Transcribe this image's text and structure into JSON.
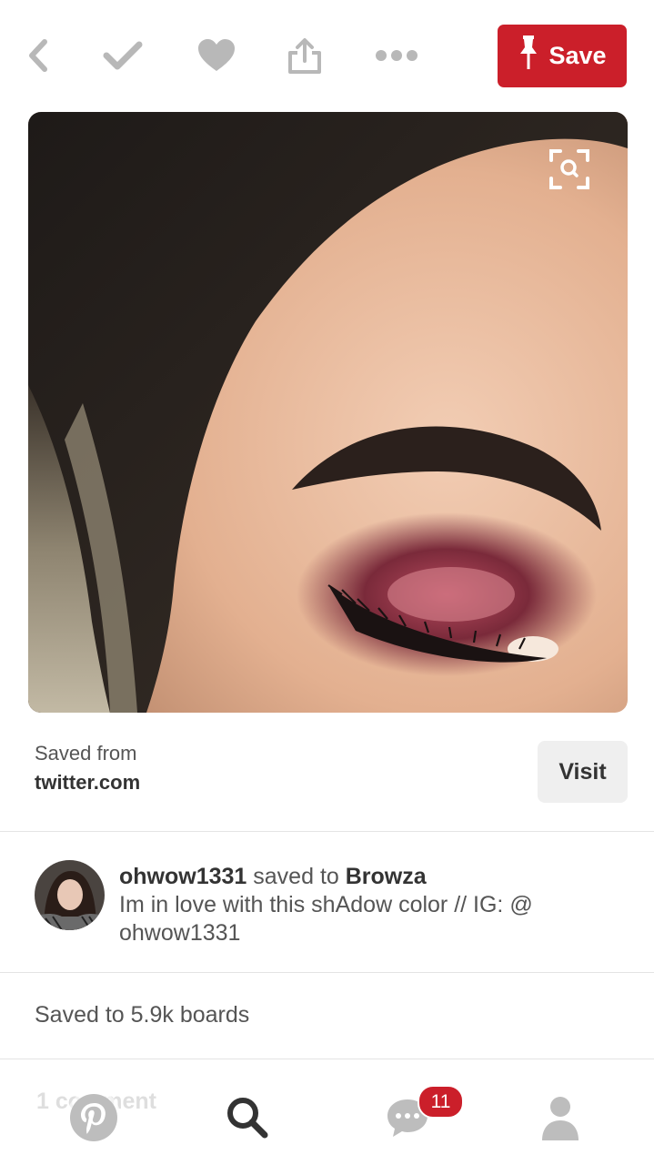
{
  "toolbar": {
    "save_label": "Save",
    "icons": [
      "back-icon",
      "check-icon",
      "heart-icon",
      "share-icon",
      "more-icon",
      "pushpin-icon"
    ]
  },
  "pin": {
    "image_zoom_icon": "visual-search-icon",
    "source_label": "Saved from",
    "source_domain": "twitter.com",
    "visit_label": "Visit",
    "username": "ohwow1331",
    "saved_to_text": "saved to",
    "board": "Browza",
    "description": "Im in love with this shAdow color // IG: @ ohwow1331",
    "saved_count": "Saved to 5.9k boards",
    "comments_ghost": "1 comment"
  },
  "bottom_nav": {
    "icons": [
      "pinterest-home-icon",
      "search-icon",
      "chat-icon",
      "profile-icon"
    ],
    "notifications_badge": "11"
  },
  "colors": {
    "brand_red": "#cb1f2a",
    "icon_gray": "#b8b8b8"
  }
}
